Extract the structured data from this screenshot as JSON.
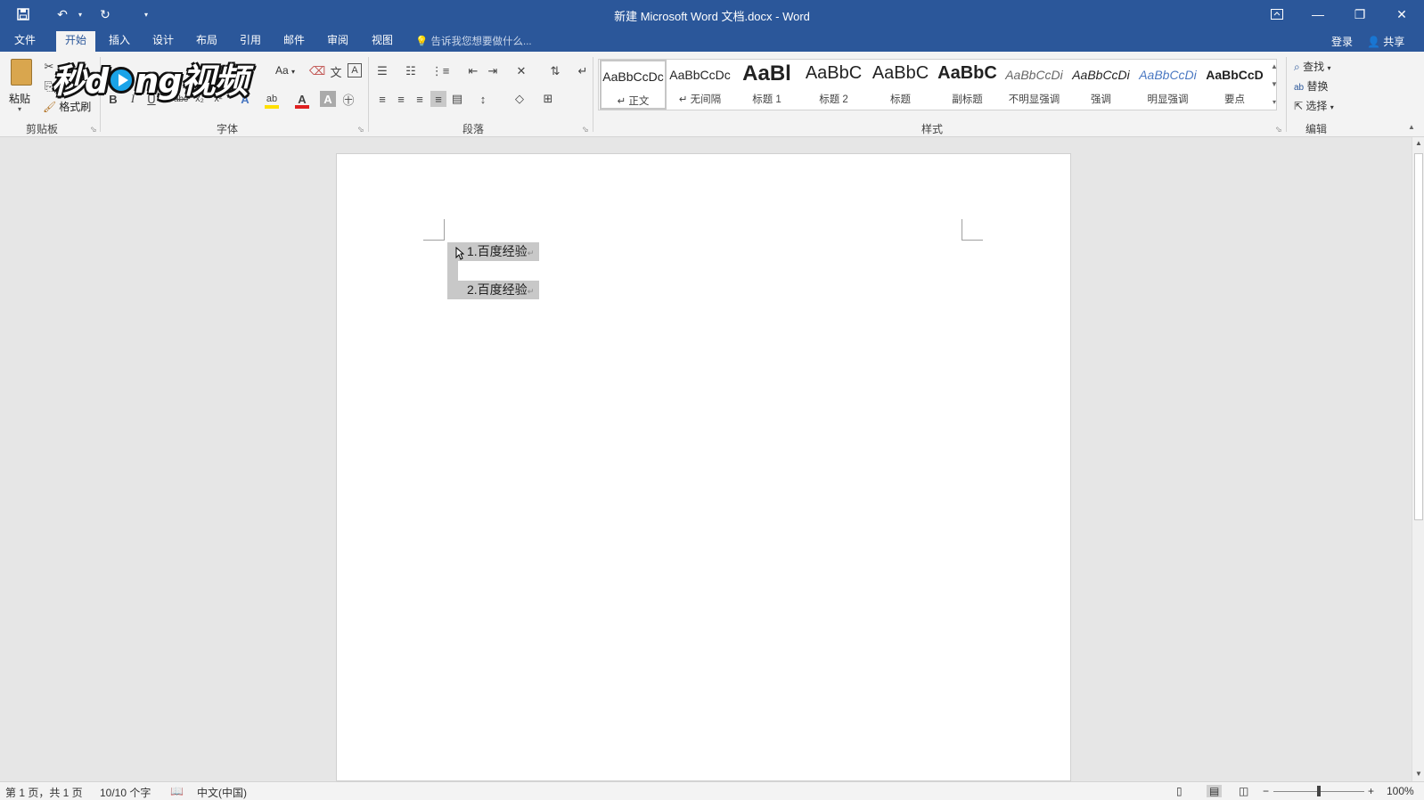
{
  "titlebar": {
    "title": "新建 Microsoft Word 文档.docx - Word",
    "save_icon": "save-icon",
    "undo_icon": "undo-icon",
    "redo_icon": "redo-icon"
  },
  "menu": {
    "tabs": [
      "文件",
      "开始",
      "插入",
      "设计",
      "布局",
      "引用",
      "邮件",
      "审阅",
      "视图"
    ],
    "active_tab": "开始",
    "tell_me": "告诉我您想要做什么...",
    "signin": "登录",
    "share": "共享"
  },
  "ribbon": {
    "clipboard": {
      "paste": "粘贴",
      "format_painter": "格式刷",
      "label": "剪贴板"
    },
    "font": {
      "label": "字体",
      "change_case": "Aa"
    },
    "paragraph": {
      "label": "段落"
    },
    "styles": {
      "label": "样式",
      "items": [
        {
          "sample": "AaBbCcDc",
          "name": "正文",
          "selected": true
        },
        {
          "sample": "AaBbCcDc",
          "name": "无间隔"
        },
        {
          "sample": "AaBl",
          "name": "标题 1"
        },
        {
          "sample": "AaBbC",
          "name": "标题 2"
        },
        {
          "sample": "AaBbC",
          "name": "标题"
        },
        {
          "sample": "AaBbC",
          "name": "副标题"
        },
        {
          "sample": "AaBbCcDi",
          "name": "不明显强调"
        },
        {
          "sample": "AaBbCcDi",
          "name": "强调"
        },
        {
          "sample": "AaBbCcDi",
          "name": "明显强调"
        },
        {
          "sample": "AaBbCcD",
          "name": "要点"
        }
      ]
    },
    "editing": {
      "find": "查找",
      "replace": "替换",
      "select": "选择",
      "label": "编辑"
    }
  },
  "logo": {
    "text_left": "秒d",
    "text_right": "ng视频"
  },
  "document": {
    "lines": [
      "1.百度经验",
      "2.百度经验"
    ],
    "para_mark": "↵"
  },
  "statusbar": {
    "page": "第 1 页，共 1 页",
    "words": "10/10 个字",
    "language": "中文(中国)",
    "zoom": "100%",
    "zoom_level": 100
  },
  "colors": {
    "brand": "#2b579a",
    "font_color": "#e02020",
    "highlight": "#ffe000"
  }
}
